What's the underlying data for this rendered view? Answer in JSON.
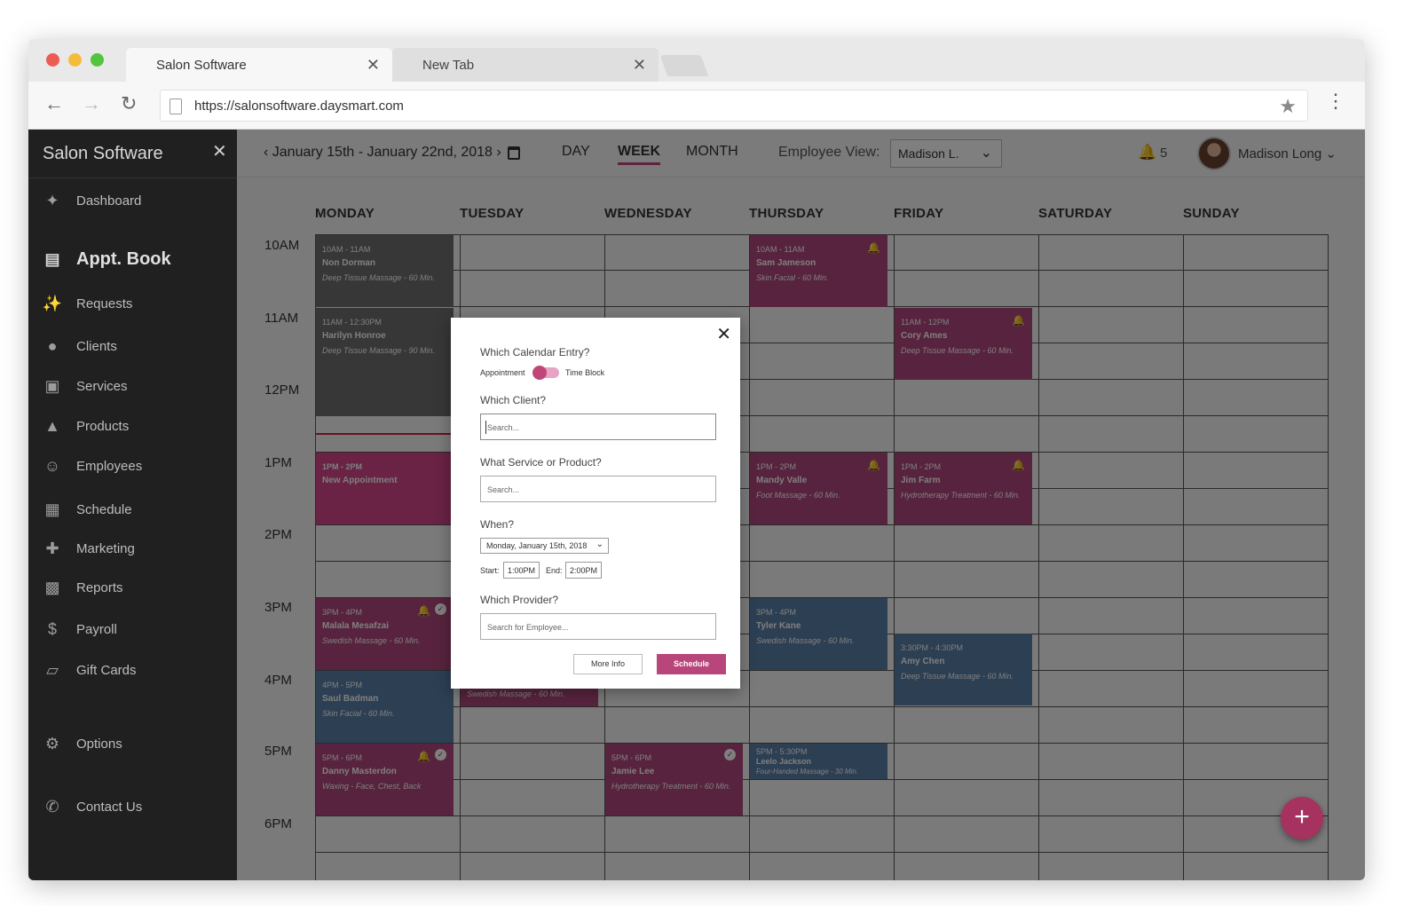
{
  "browser": {
    "tabs": [
      {
        "label": "Salon Software",
        "close": "✕"
      },
      {
        "label": "New Tab",
        "close": "✕"
      }
    ],
    "url": "https://salonsoftware.daysmart.com"
  },
  "sidebar": {
    "title": "Salon Software",
    "close": "✕",
    "items": [
      {
        "label": "Dashboard",
        "icon": "dashboard-icon"
      },
      {
        "label": "Appt. Book",
        "icon": "calendar-icon"
      },
      {
        "label": "Requests",
        "icon": "requests-icon"
      },
      {
        "label": "Clients",
        "icon": "clients-icon"
      },
      {
        "label": "Services",
        "icon": "services-icon"
      },
      {
        "label": "Products",
        "icon": "products-icon"
      },
      {
        "label": "Employees",
        "icon": "employees-icon"
      },
      {
        "label": "Schedule",
        "icon": "schedule-icon"
      },
      {
        "label": "Marketing",
        "icon": "marketing-icon"
      },
      {
        "label": "Reports",
        "icon": "reports-icon"
      },
      {
        "label": "Payroll",
        "icon": "payroll-icon"
      },
      {
        "label": "Gift Cards",
        "icon": "gift-cards-icon"
      },
      {
        "label": "Options",
        "icon": "gear-icon"
      },
      {
        "label": "Contact Us",
        "icon": "phone-icon"
      }
    ]
  },
  "header": {
    "date_range": "January 15th - January 22nd, 2018",
    "views": [
      "DAY",
      "WEEK",
      "MONTH"
    ],
    "active_view": "WEEK",
    "employee_view_label": "Employee View:",
    "employee_selected": "Madison L.",
    "notifications": "5",
    "user_name": "Madison Long"
  },
  "calendar": {
    "days": [
      "MONDAY",
      "TUESDAY",
      "WEDNESDAY",
      "THURSDAY",
      "FRIDAY",
      "SATURDAY",
      "SUNDAY"
    ],
    "times": [
      "10AM",
      "11AM",
      "12PM",
      "1PM",
      "2PM",
      "3PM",
      "4PM",
      "5PM",
      "6PM"
    ],
    "appointments": [
      {
        "time": "10AM - 11AM",
        "name": "Non Dorman",
        "service": "Deep Tissue Massage - 60 Min."
      },
      {
        "time": "11AM - 12:30PM",
        "name": "Harilyn Honroe",
        "service": "Deep Tissue Massage - 90 Min."
      },
      {
        "time": "1PM - 2PM",
        "name": "New Appointment",
        "service": ""
      },
      {
        "time": "3PM - 4PM",
        "name": "Malala Mesafzai",
        "service": "Swedish Massage - 60 Min."
      },
      {
        "time": "4PM - 5PM",
        "name": "Saul Badman",
        "service": "Skin Facial - 60 Min."
      },
      {
        "time": "5PM - 6PM",
        "name": "Danny Masterdon",
        "service": "Waxing - Face, Chest, Back"
      },
      {
        "time": "5PM - 6PM",
        "name": "Jamie Lee",
        "service": "Hydrotherapy Treatment - 60 Min."
      },
      {
        "time": "10AM - 11AM",
        "name": "Sam Jameson",
        "service": "Skin Facial - 60 Min."
      },
      {
        "time": "1PM - 2PM",
        "name": "Mandy Valle",
        "service": "Foot Massage - 60 Min."
      },
      {
        "time": "3PM - 4PM",
        "name": "Tyler Kane",
        "service": "Swedish Massage - 60 Min."
      },
      {
        "time": "5PM - 5:30PM",
        "name": "Leelo Jackson",
        "service": "Four-Handed Massage - 30 Min."
      },
      {
        "time": "11AM - 12PM",
        "name": "Cory Ames",
        "service": "Deep Tissue Massage - 60 Min."
      },
      {
        "time": "1PM - 2PM",
        "name": "Jim Farm",
        "service": "Hydrotherapy Treatment - 60 Min."
      },
      {
        "time": "3:30PM - 4:30PM",
        "name": "Amy Chen",
        "service": "Deep Tissue Massage - 60 Min."
      },
      {
        "time": "",
        "name": "",
        "service": "Swedish Massage - 60 Min."
      }
    ]
  },
  "modal": {
    "close": "✕",
    "entry_label": "Which Calendar Entry?",
    "toggle_left": "Appointment",
    "toggle_right": "Time Block",
    "client_label": "Which Client?",
    "client_placeholder": "Search...",
    "service_label": "What Service or Product?",
    "service_placeholder": "Search...",
    "when_label": "When?",
    "date_value": "Monday, January 15th, 2018",
    "start_label": "Start:",
    "start_value": "1:00PM",
    "end_label": "End:",
    "end_value": "2:00PM",
    "provider_label": "Which Provider?",
    "provider_placeholder": "Search for Employee...",
    "more_info": "More Info",
    "schedule": "Schedule"
  },
  "fab": "+",
  "colors": {
    "accent": "#c0467a",
    "appointment_plum": "#b0467c",
    "appointment_blue": "#5b7fa6"
  }
}
